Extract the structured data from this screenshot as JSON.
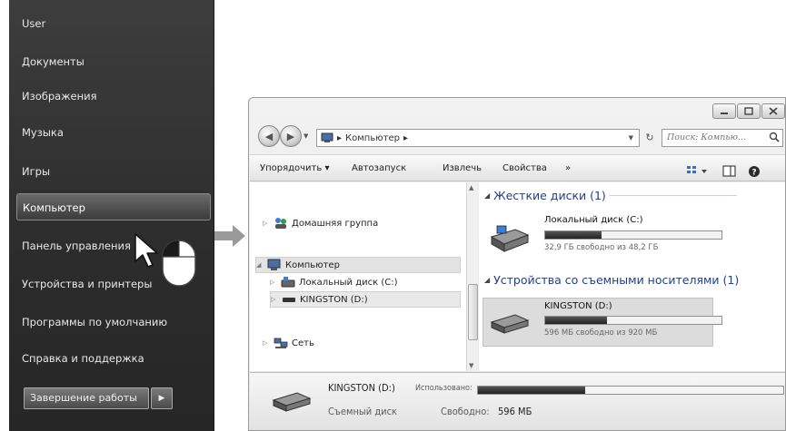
{
  "start_menu": {
    "items": [
      {
        "label": "User"
      },
      {
        "label": "Документы"
      },
      {
        "label": "Изображения"
      },
      {
        "label": "Музыка"
      },
      {
        "label": "Игры"
      },
      {
        "label": "Компьютер",
        "active": true
      },
      {
        "label": "Панель управления"
      },
      {
        "label": "Устройства и принтеры"
      },
      {
        "label": "Программы по умолчанию"
      },
      {
        "label": "Справка и поддержка"
      }
    ],
    "shutdown_label": "Завершение работы",
    "shutdown_arrow": "▶"
  },
  "explorer": {
    "address": {
      "crumb": "Компьютер",
      "sep1": "▸",
      "sep2": "▸"
    },
    "search_placeholder": "Поиск: Компью...",
    "toolbar": {
      "organize": "Упорядочить ▾",
      "autoplay": "Автозапуск",
      "eject": "Извлечь",
      "properties": "Свойства",
      "more": "»"
    },
    "nav_pane": {
      "homegroup": "Домашняя группа",
      "computer": "Компьютер",
      "local_disk": "Локальный диск (C:)",
      "kingston": "KINGSTON (D:)",
      "network": "Сеть"
    },
    "content": {
      "hard_disks_header": "Жесткие диски (1)",
      "removable_header": "Устройства со съемными носителями (1)",
      "drives": [
        {
          "name": "Локальный диск (C:)",
          "free_text": "32,9 ГБ свободно из 48,2 ГБ",
          "used_fraction": 0.32
        },
        {
          "name": "KINGSTON (D:)",
          "free_text": "596 МБ свободно из 920 МБ",
          "used_fraction": 0.35
        }
      ]
    },
    "details": {
      "name": "KINGSTON (D:)",
      "used_label": "Использовано:",
      "type": "Съемный диск",
      "free_label": "Свободно:",
      "free_value": "596 МБ",
      "used_fraction": 0.35
    }
  },
  "colors": {
    "accent_header": "#1e3f8a",
    "start_bg": "#333333"
  }
}
